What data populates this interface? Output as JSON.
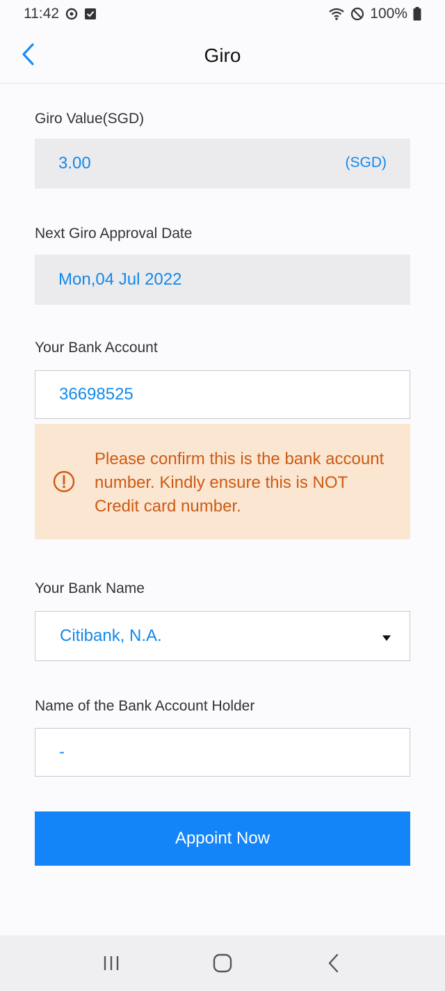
{
  "status_bar": {
    "time": "11:42",
    "battery_text": "100%",
    "icons": [
      "sync-icon",
      "checkbox-notification-icon",
      "wifi-icon",
      "do-not-disturb-icon",
      "battery-icon"
    ]
  },
  "nav": {
    "title": "Giro",
    "back_icon": "chevron-left-icon"
  },
  "form": {
    "giro_value": {
      "label": "Giro Value(SGD)",
      "value": "3.00",
      "unit": "(SGD)"
    },
    "approval_date": {
      "label": "Next Giro Approval Date",
      "value": "Mon,04 Jul 2022"
    },
    "bank_account": {
      "label": "Your Bank Account",
      "value": "36698525"
    },
    "warning": {
      "icon": "exclamation-circle-icon",
      "text": "Please confirm this is the bank account number. Kindly ensure this is NOT Credit card number."
    },
    "bank_name": {
      "label": "Your Bank Name",
      "value": "Citibank, N.A."
    },
    "account_holder": {
      "label": "Name of the Bank Account Holder",
      "value": "-"
    }
  },
  "actions": {
    "appoint_label": "Appoint Now"
  },
  "system_nav": {
    "icons": [
      "recent-apps-icon",
      "home-icon",
      "back-icon"
    ]
  },
  "colors": {
    "accent": "#1485f8",
    "value_text": "#1488e8",
    "warning_bg": "#fbe6d2",
    "warning_text": "#cd5a13"
  }
}
